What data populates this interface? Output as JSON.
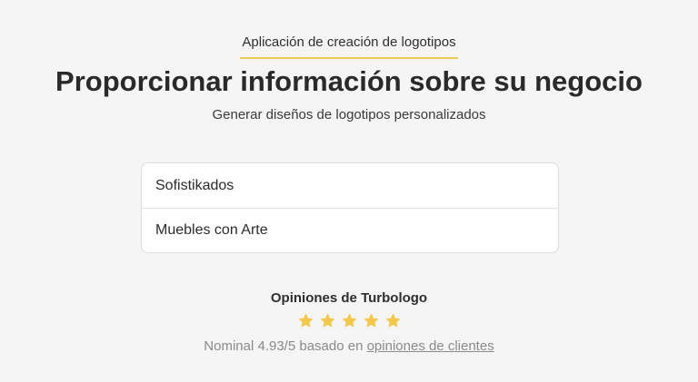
{
  "header": {
    "eyebrow": "Aplicación de creación de logotipos",
    "title": "Proporcionar información sobre su negocio",
    "subtitle": "Generar diseños de logotipos personalizados"
  },
  "form": {
    "business_name": "Sofistikados",
    "business_slogan": "Muebles con Arte"
  },
  "reviews": {
    "title": "Opiniones de Turbologo",
    "stars": 5,
    "star_icon": "star-icon",
    "star_color": "#f2c94c",
    "rating_prefix": "Nominal 4.93/5 basado en",
    "rating_link": "opiniones de clientes"
  },
  "colors": {
    "accent": "#f2c94c",
    "background": "#f5f5f5"
  }
}
